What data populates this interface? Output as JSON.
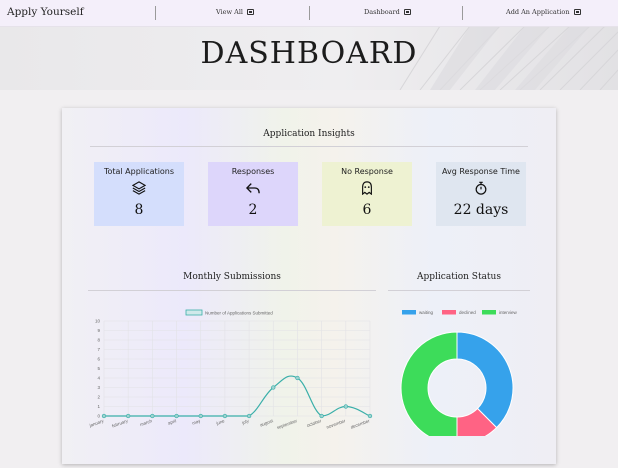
{
  "nav": {
    "brand": "Apply Yourself",
    "links": [
      {
        "label": "View All",
        "icon": "box-arrow-icon"
      },
      {
        "label": "Dashboard",
        "icon": "box-arrow-icon"
      },
      {
        "label": "Add An Application",
        "icon": "plus-square-icon"
      }
    ]
  },
  "hero": {
    "title": "DASHBOARD"
  },
  "insights": {
    "title": "Application Insights",
    "cards": [
      {
        "label": "Total Applications",
        "value": "8",
        "icon": "layers-icon",
        "color": "#d4defc"
      },
      {
        "label": "Responses",
        "value": "2",
        "icon": "reply-icon",
        "color": "#ddd6fb"
      },
      {
        "label": "No Response",
        "value": "6",
        "icon": "ghost-icon",
        "color": "#eef2d2"
      },
      {
        "label": "Avg Response Time",
        "value": "22 days",
        "icon": "stopwatch-icon",
        "color": "#dfe6f0"
      }
    ]
  },
  "monthly": {
    "title": "Monthly Submissions"
  },
  "status": {
    "title": "Application Status"
  },
  "chart_data": [
    {
      "type": "line",
      "title": "",
      "xlabel": "",
      "ylabel": "",
      "categories": [
        "january",
        "february",
        "march",
        "april",
        "may",
        "june",
        "july",
        "august",
        "september",
        "october",
        "november",
        "december"
      ],
      "series": [
        {
          "name": "Number of Applications Submitted",
          "values": [
            0,
            0,
            0,
            0,
            0,
            0,
            0,
            3,
            4,
            0,
            1,
            0
          ],
          "color": "#3aafa9"
        }
      ],
      "ylim": [
        0,
        10
      ],
      "yticks": [
        0,
        1,
        2,
        3,
        4,
        5,
        6,
        7,
        8,
        9,
        10
      ],
      "grid": true,
      "legend": "top"
    },
    {
      "type": "pie",
      "title": "",
      "categories": [
        "waiting",
        "declined",
        "interview"
      ],
      "values": [
        3,
        1,
        4
      ],
      "colors": [
        "#36a2eb",
        "#ff6384",
        "#3ddc5a"
      ],
      "legend": "top"
    }
  ]
}
